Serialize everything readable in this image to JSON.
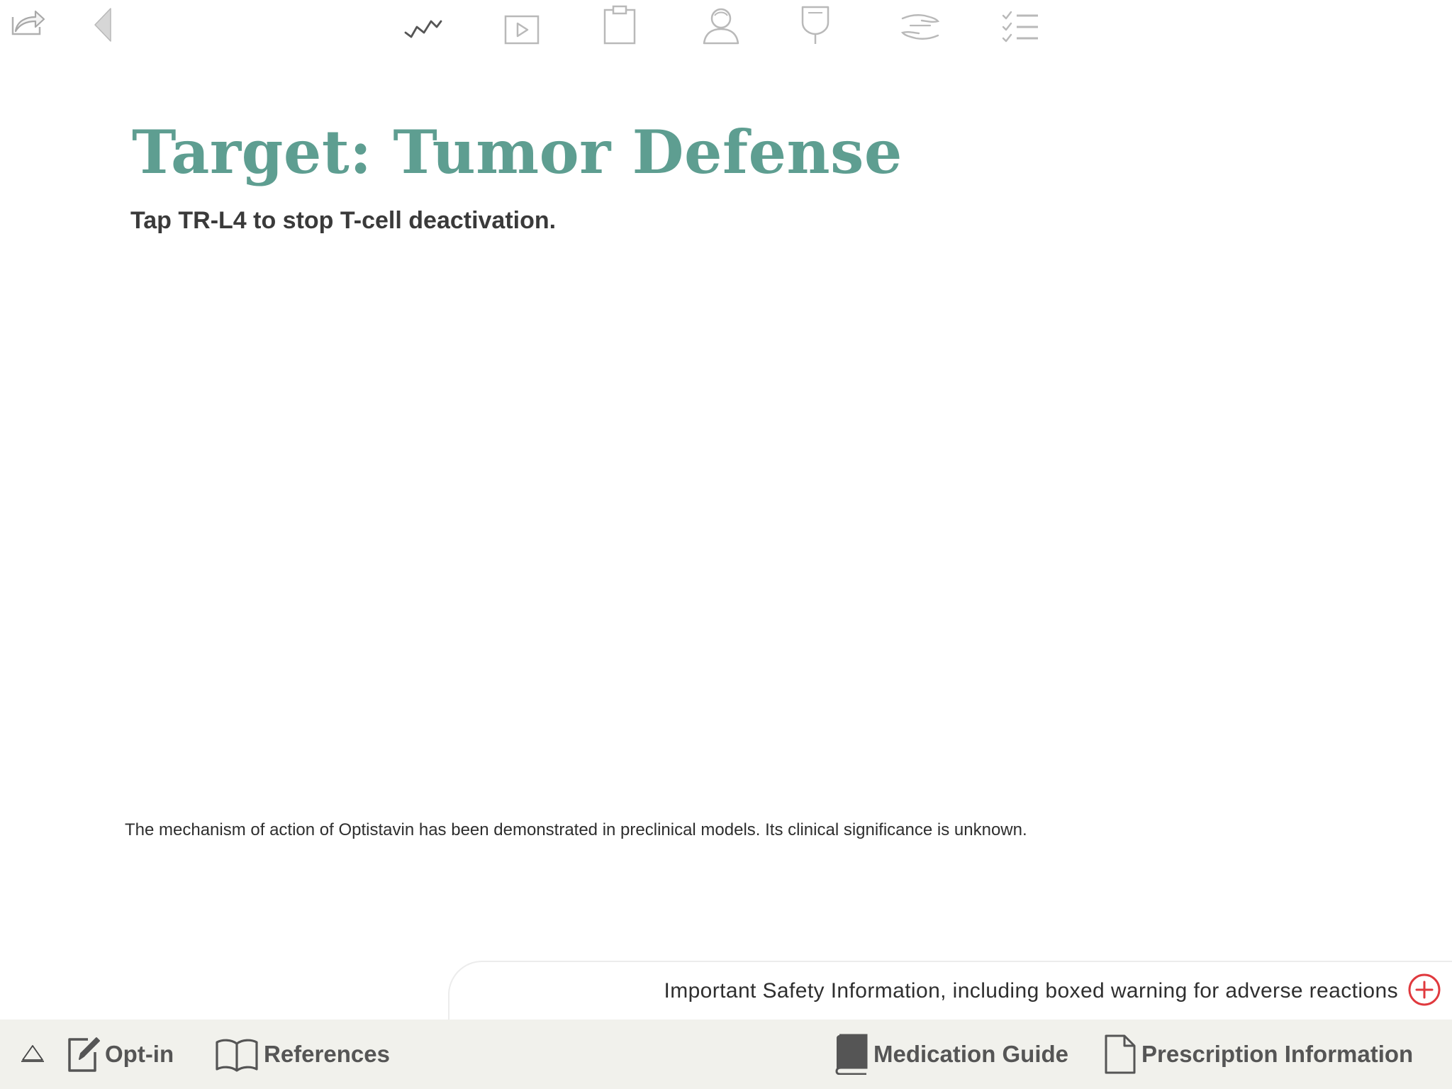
{
  "topbar": {
    "icons": [
      {
        "name": "share-icon"
      },
      {
        "name": "back-arrow-icon"
      },
      {
        "name": "trend-line-icon"
      },
      {
        "name": "video-play-icon"
      },
      {
        "name": "clipboard-icon"
      },
      {
        "name": "patient-icon"
      },
      {
        "name": "iv-bag-icon"
      },
      {
        "name": "hands-icon"
      },
      {
        "name": "checklist-icon"
      }
    ]
  },
  "main": {
    "title": "Target: Tumor Defense",
    "subtitle": "Tap TR-L4 to stop T-cell deactivation.",
    "disclaimer": "The mechanism of action of Optistavin has been demonstrated in preclinical models. Its clinical significance is unknown."
  },
  "safety": {
    "label": "Important Safety Information, including boxed warning for adverse reactions",
    "icon": "plus-circle-icon"
  },
  "bottombar": {
    "items": [
      {
        "label": "Opt-in",
        "icon": "edit-icon"
      },
      {
        "label": "References",
        "icon": "open-book-icon"
      },
      {
        "label": "Medication Guide",
        "icon": "book-icon"
      },
      {
        "label": "Prescription Information",
        "icon": "document-icon"
      }
    ]
  },
  "colors": {
    "accent": "#5e9e91",
    "alert": "#e0393e",
    "bar_bg": "#f1f1ec",
    "icon_gray": "#b9b9b9"
  }
}
